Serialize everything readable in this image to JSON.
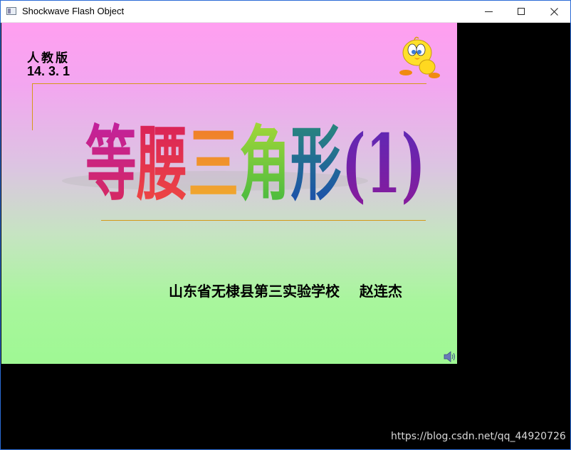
{
  "window": {
    "title": "Shockwave Flash Object",
    "controls": {
      "minimize": "minimize",
      "maximize": "maximize",
      "close": "close"
    }
  },
  "slide": {
    "edition": "人教版",
    "date": "14. 3. 1",
    "title_chars": [
      "等",
      "腰",
      "三",
      "角",
      "形",
      "(1)"
    ],
    "author_line": "山东省无棣县第三实验学校    赵连杰",
    "colors": {
      "title": [
        "#c8246e",
        "#e8326a",
        "#f08a28",
        "#66c83a",
        "#1a6aa8",
        "#7a2aa8"
      ],
      "rule": "#d49a18"
    }
  },
  "watermark": "https://blog.csdn.net/qq_44920726"
}
